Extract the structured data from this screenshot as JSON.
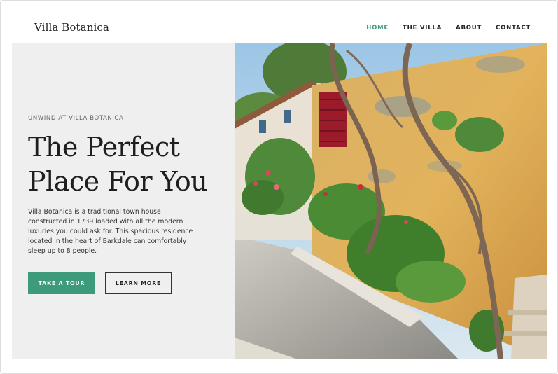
{
  "site": {
    "logo": "Villa Botanica"
  },
  "nav": {
    "items": [
      {
        "label": "HOME",
        "active": true
      },
      {
        "label": "THE VILLA",
        "active": false
      },
      {
        "label": "ABOUT",
        "active": false
      },
      {
        "label": "CONTACT",
        "active": false
      }
    ]
  },
  "hero": {
    "eyebrow": "UNWIND AT VILLA BOTANICA",
    "headline_line1": "The Perfect",
    "headline_line2": "Place For You",
    "body": "Villa Botanica is a traditional town house constructed in 1739 loaded with all the modern luxuries you could ask for. This spacious residence located in the heart of Barkdale can comfortably sleep up to 8 people.",
    "primary_button": "TAKE A TOUR",
    "secondary_button": "LEARN MORE"
  },
  "theme": {
    "accent": "#3d9a7b",
    "panel_bg": "#efefef"
  }
}
